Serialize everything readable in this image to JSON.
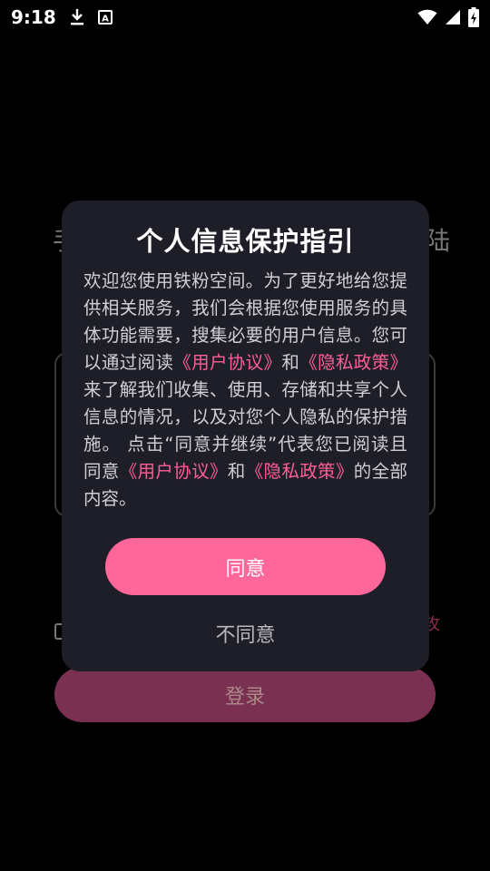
{
  "status_bar": {
    "time": "9:18",
    "icons": [
      "download-icon",
      "text-notification-icon",
      "wifi-icon",
      "signal-icon",
      "battery-charging-icon"
    ]
  },
  "background": {
    "title_left": "手",
    "title_right": "陆",
    "agree_tail": "攻",
    "login_label": "登录"
  },
  "dialog": {
    "title": "个人信息保护指引",
    "body": {
      "p1": "欢迎您使用铁粉空间。为了更好地给您提供相关服务，我们会根据您使用服务的具体功能需要，搜集必要的用户信息。您可以通过阅读",
      "link1": "《用户协议》",
      "p2": "和",
      "link2": "《隐私政策》",
      "p3": "来了解我们收集、使用、存储和共享个人信息的情况，以及对您个人隐私的保护措施。 点击“同意并继续”代表您已阅读且同意",
      "link3": "《用户协议》",
      "p4": "和",
      "link4": "《隐私政策》",
      "p5": "的全部内容。"
    },
    "agree_label": "同意",
    "disagree_label": "不同意"
  },
  "colors": {
    "accent": "#ff6699",
    "link": "#ff5f95",
    "dialog_bg": "#1e1e29"
  }
}
